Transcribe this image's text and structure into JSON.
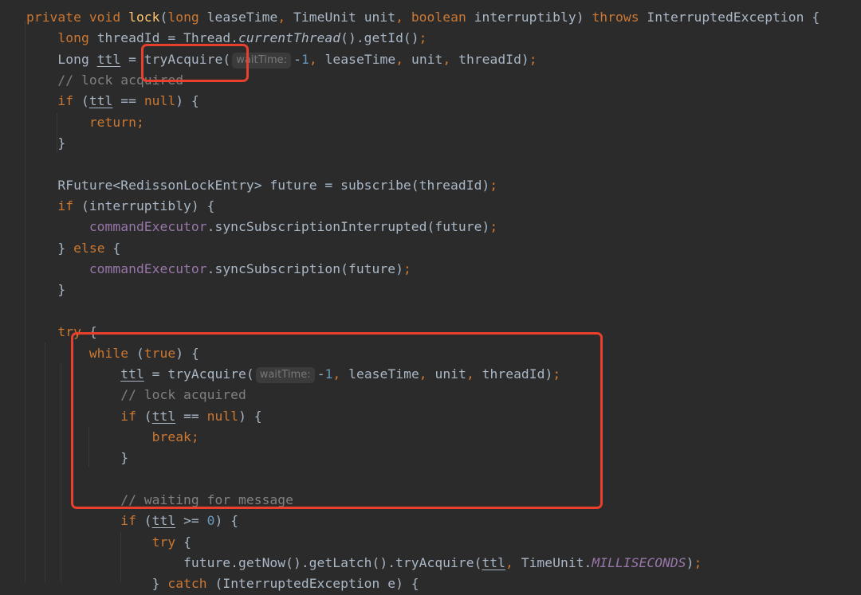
{
  "editor": {
    "theme": "darcula",
    "colors": {
      "background": "#2b2b2b",
      "keyword": "#cc7832",
      "plain": "#a9b7c6",
      "method_decl": "#ffc66d",
      "field": "#9876aa",
      "number": "#6897bb",
      "comment": "#808080",
      "highlight_box": "#e8402d"
    },
    "lines": [
      {
        "indent": 0,
        "tokens": [
          {
            "t": "kw",
            "v": "private "
          },
          {
            "t": "kw",
            "v": "void "
          },
          {
            "t": "fn",
            "v": "lock"
          },
          {
            "t": "plain",
            "v": "("
          },
          {
            "t": "kw",
            "v": "long "
          },
          {
            "t": "plain",
            "v": "leaseTime"
          },
          {
            "t": "punct",
            "v": ", "
          },
          {
            "t": "plain",
            "v": "TimeUnit unit"
          },
          {
            "t": "punct",
            "v": ", "
          },
          {
            "t": "kw",
            "v": "boolean "
          },
          {
            "t": "plain",
            "v": "interruptibly) "
          },
          {
            "t": "kw",
            "v": "throws "
          },
          {
            "t": "plain",
            "v": "InterruptedException {"
          }
        ]
      },
      {
        "indent": 1,
        "tokens": [
          {
            "t": "kw",
            "v": "long "
          },
          {
            "t": "plain",
            "v": "threadId = Thread."
          },
          {
            "t": "static",
            "v": "currentThread"
          },
          {
            "t": "plain",
            "v": "().getId()"
          },
          {
            "t": "punct",
            "v": ";"
          }
        ]
      },
      {
        "indent": 1,
        "tokens": [
          {
            "t": "plain",
            "v": "Long "
          },
          {
            "t": "var",
            "v": "ttl"
          },
          {
            "t": "plain",
            "v": " = tryAcquire("
          },
          {
            "t": "hint",
            "v": "waitTime:"
          },
          {
            "t": "plain",
            "v": "-"
          },
          {
            "t": "num",
            "v": "1"
          },
          {
            "t": "punct",
            "v": ", "
          },
          {
            "t": "plain",
            "v": "leaseTime"
          },
          {
            "t": "punct",
            "v": ", "
          },
          {
            "t": "plain",
            "v": "unit"
          },
          {
            "t": "punct",
            "v": ", "
          },
          {
            "t": "plain",
            "v": "threadId)"
          },
          {
            "t": "punct",
            "v": ";"
          }
        ]
      },
      {
        "indent": 1,
        "tokens": [
          {
            "t": "comment",
            "v": "// lock acquired"
          }
        ]
      },
      {
        "indent": 1,
        "tokens": [
          {
            "t": "kw",
            "v": "if "
          },
          {
            "t": "plain",
            "v": "("
          },
          {
            "t": "var",
            "v": "ttl"
          },
          {
            "t": "plain",
            "v": " == "
          },
          {
            "t": "kw",
            "v": "null"
          },
          {
            "t": "plain",
            "v": ") {"
          }
        ]
      },
      {
        "indent": 2,
        "tokens": [
          {
            "t": "kw",
            "v": "return;"
          }
        ]
      },
      {
        "indent": 1,
        "tokens": [
          {
            "t": "plain",
            "v": "}"
          }
        ]
      },
      {
        "indent": 0,
        "tokens": []
      },
      {
        "indent": 1,
        "tokens": [
          {
            "t": "plain",
            "v": "RFuture<RedissonLockEntry> future = subscribe(threadId)"
          },
          {
            "t": "punct",
            "v": ";"
          }
        ]
      },
      {
        "indent": 1,
        "tokens": [
          {
            "t": "kw",
            "v": "if "
          },
          {
            "t": "plain",
            "v": "(interruptibly) {"
          }
        ]
      },
      {
        "indent": 2,
        "tokens": [
          {
            "t": "field",
            "v": "commandExecutor"
          },
          {
            "t": "plain",
            "v": ".syncSubscriptionInterrupted(future)"
          },
          {
            "t": "punct",
            "v": ";"
          }
        ]
      },
      {
        "indent": 1,
        "tokens": [
          {
            "t": "plain",
            "v": "} "
          },
          {
            "t": "kw",
            "v": "else "
          },
          {
            "t": "plain",
            "v": "{"
          }
        ]
      },
      {
        "indent": 2,
        "tokens": [
          {
            "t": "field",
            "v": "commandExecutor"
          },
          {
            "t": "plain",
            "v": ".syncSubscription(future)"
          },
          {
            "t": "punct",
            "v": ";"
          }
        ]
      },
      {
        "indent": 1,
        "tokens": [
          {
            "t": "plain",
            "v": "}"
          }
        ]
      },
      {
        "indent": 0,
        "tokens": []
      },
      {
        "indent": 1,
        "tokens": [
          {
            "t": "kw",
            "v": "try "
          },
          {
            "t": "plain",
            "v": "{"
          }
        ]
      },
      {
        "indent": 2,
        "tokens": [
          {
            "t": "kw",
            "v": "while "
          },
          {
            "t": "plain",
            "v": "("
          },
          {
            "t": "kw",
            "v": "true"
          },
          {
            "t": "plain",
            "v": ") {"
          }
        ]
      },
      {
        "indent": 3,
        "tokens": [
          {
            "t": "var",
            "v": "ttl"
          },
          {
            "t": "plain",
            "v": " = tryAcquire("
          },
          {
            "t": "hint",
            "v": "waitTime:"
          },
          {
            "t": "plain",
            "v": "-"
          },
          {
            "t": "num",
            "v": "1"
          },
          {
            "t": "punct",
            "v": ", "
          },
          {
            "t": "plain",
            "v": "leaseTime"
          },
          {
            "t": "punct",
            "v": ", "
          },
          {
            "t": "plain",
            "v": "unit"
          },
          {
            "t": "punct",
            "v": ", "
          },
          {
            "t": "plain",
            "v": "threadId)"
          },
          {
            "t": "punct",
            "v": ";"
          }
        ]
      },
      {
        "indent": 3,
        "tokens": [
          {
            "t": "comment",
            "v": "// lock acquired"
          }
        ]
      },
      {
        "indent": 3,
        "tokens": [
          {
            "t": "kw",
            "v": "if "
          },
          {
            "t": "plain",
            "v": "("
          },
          {
            "t": "var",
            "v": "ttl"
          },
          {
            "t": "plain",
            "v": " == "
          },
          {
            "t": "kw",
            "v": "null"
          },
          {
            "t": "plain",
            "v": ") {"
          }
        ]
      },
      {
        "indent": 4,
        "tokens": [
          {
            "t": "kw",
            "v": "break;"
          }
        ]
      },
      {
        "indent": 3,
        "tokens": [
          {
            "t": "plain",
            "v": "}"
          }
        ]
      },
      {
        "indent": 0,
        "tokens": []
      },
      {
        "indent": 3,
        "tokens": [
          {
            "t": "comment",
            "v": "// waiting for message"
          }
        ]
      },
      {
        "indent": 3,
        "tokens": [
          {
            "t": "kw",
            "v": "if "
          },
          {
            "t": "plain",
            "v": "("
          },
          {
            "t": "var",
            "v": "ttl"
          },
          {
            "t": "plain",
            "v": " >= "
          },
          {
            "t": "num",
            "v": "0"
          },
          {
            "t": "plain",
            "v": ") {"
          }
        ]
      },
      {
        "indent": 4,
        "tokens": [
          {
            "t": "kw",
            "v": "try "
          },
          {
            "t": "plain",
            "v": "{"
          }
        ]
      },
      {
        "indent": 5,
        "tokens": [
          {
            "t": "plain",
            "v": "future.getNow().getLatch().tryAcquire("
          },
          {
            "t": "var",
            "v": "ttl"
          },
          {
            "t": "punct",
            "v": ", "
          },
          {
            "t": "plain",
            "v": "TimeUnit."
          },
          {
            "t": "const",
            "v": "MILLISECONDS"
          },
          {
            "t": "plain",
            "v": ")"
          },
          {
            "t": "punct",
            "v": ";"
          }
        ]
      },
      {
        "indent": 4,
        "tokens": [
          {
            "t": "plain",
            "v": "} "
          },
          {
            "t": "kw",
            "v": "catch "
          },
          {
            "t": "plain",
            "v": "(InterruptedException e) {"
          }
        ]
      }
    ]
  },
  "annotations": [
    {
      "name": "highlight-try-acquire-call",
      "target": "tryAcquire("
    },
    {
      "name": "highlight-while-loop",
      "target": "while (true) loop block"
    }
  ]
}
